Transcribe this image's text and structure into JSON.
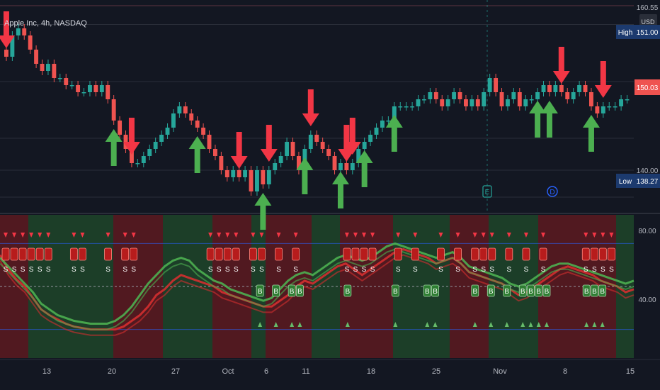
{
  "header": {
    "symbol_label": "Apple Inc, 4h, NASDAQ"
  },
  "price_axis": {
    "ticks": [
      "160.55",
      "140.00"
    ],
    "currency": "USD",
    "high_label": "High",
    "high_value": "151.00",
    "last_value": "150.03",
    "low_label": "Low",
    "low_value": "138.27"
  },
  "indicator_axis": {
    "ticks": [
      "80.00",
      "40.00"
    ]
  },
  "time_axis": {
    "ticks": [
      "13",
      "20",
      "27",
      "Oct",
      "6",
      "11",
      "18",
      "25",
      "Nov",
      "8",
      "15"
    ]
  },
  "events": [
    {
      "letter": "E"
    },
    {
      "letter": "D"
    }
  ],
  "colors": {
    "background": "#131722",
    "up": "#26a69a",
    "down": "#ef5350",
    "buy_arrow": "#4caf50",
    "sell_arrow": "#f23645",
    "signal_buy": "#2e7d32",
    "signal_sell": "#b71c1c",
    "event_blue": "#2962ff",
    "label_navy": "#1c3a6e"
  },
  "chart_data": [
    {
      "type": "candlestick",
      "title": "Apple Inc, 4h, NASDAQ",
      "x_ticks": [
        "13",
        "20",
        "27",
        "Oct",
        "6",
        "11",
        "18",
        "25",
        "Nov",
        "8",
        "15"
      ],
      "ylim": [
        134,
        164
      ],
      "closes": [
        156,
        159,
        160,
        159,
        157,
        155,
        154,
        155,
        153,
        153,
        152,
        152,
        151,
        151,
        152,
        151,
        152,
        150,
        147,
        145,
        143,
        141,
        141,
        142,
        143,
        144,
        145,
        146,
        148,
        149,
        148,
        147,
        146,
        145,
        143,
        142,
        140,
        139,
        140,
        139,
        140,
        137,
        140,
        138,
        140,
        141,
        142,
        144,
        142,
        140,
        143,
        145,
        144,
        143,
        142,
        140,
        141,
        140,
        141,
        143,
        144,
        145,
        146,
        147,
        147,
        149,
        149,
        149,
        149,
        150,
        150,
        151,
        150,
        149,
        150,
        151,
        150,
        149,
        150,
        149,
        151,
        153,
        151,
        149,
        150,
        151,
        149,
        150,
        150,
        151,
        152,
        151,
        152,
        151,
        150,
        151,
        152,
        151,
        149,
        148,
        149,
        149,
        149,
        150,
        150
      ],
      "buy_arrow_indices": [
        18,
        32,
        43,
        50,
        56,
        60,
        65,
        89,
        91,
        98,
        110
      ],
      "sell_arrow_indices": [
        0,
        21,
        39,
        44,
        51,
        57,
        58,
        93,
        100
      ],
      "annotations": [
        "High",
        "Low",
        "E",
        "D"
      ]
    },
    {
      "type": "line",
      "title": "",
      "ylim": [
        0,
        100
      ],
      "y_ticks": [
        80,
        40
      ],
      "series": [
        {
          "color": "#d32f2f",
          "values": [
            72,
            62,
            55,
            50,
            42,
            34,
            30,
            27,
            24,
            22,
            21,
            20,
            20,
            20,
            20,
            22,
            26,
            30,
            36,
            44,
            48,
            54,
            58,
            56,
            54,
            52,
            50,
            46,
            44,
            42,
            40,
            38,
            36,
            36,
            40,
            44,
            50,
            54,
            52,
            56,
            60,
            64,
            66,
            62,
            58,
            62,
            66,
            70,
            74,
            76,
            74,
            72,
            70,
            66,
            68,
            70,
            66,
            60,
            58,
            56,
            54,
            52,
            48,
            44,
            46,
            50,
            54,
            58,
            62,
            64,
            62,
            60,
            58,
            54,
            52,
            50,
            46,
            48
          ]
        },
        {
          "color": "#4caf50",
          "values": [
            70,
            64,
            58,
            52,
            46,
            38,
            34,
            30,
            28,
            26,
            25,
            24,
            24,
            24,
            26,
            30,
            36,
            44,
            52,
            58,
            64,
            68,
            70,
            68,
            62,
            58,
            54,
            52,
            48,
            46,
            44,
            42,
            40,
            42,
            48,
            54,
            58,
            60,
            58,
            62,
            66,
            70,
            72,
            70,
            68,
            70,
            74,
            78,
            80,
            78,
            76,
            74,
            72,
            70,
            72,
            74,
            70,
            64,
            62,
            60,
            58,
            56,
            52,
            50,
            52,
            56,
            60,
            64,
            66,
            66,
            64,
            62,
            60,
            58,
            56,
            54,
            52,
            54
          ]
        }
      ],
      "buy_signal_indices": [
        17,
        19,
        21,
        22,
        28,
        34,
        38,
        39,
        44,
        46,
        48,
        50,
        51,
        52,
        53,
        58,
        59,
        60,
        65,
        66,
        67,
        75,
        76,
        77
      ],
      "sell_signal_indices": [
        0,
        1,
        2,
        3,
        4,
        5,
        8,
        9,
        12,
        14,
        15,
        24,
        25,
        26,
        27,
        29,
        30,
        32,
        34,
        40,
        41,
        42,
        43,
        46,
        48,
        51,
        53,
        55,
        56,
        57,
        59,
        61,
        63,
        68,
        69,
        70,
        71,
        72
      ]
    }
  ]
}
